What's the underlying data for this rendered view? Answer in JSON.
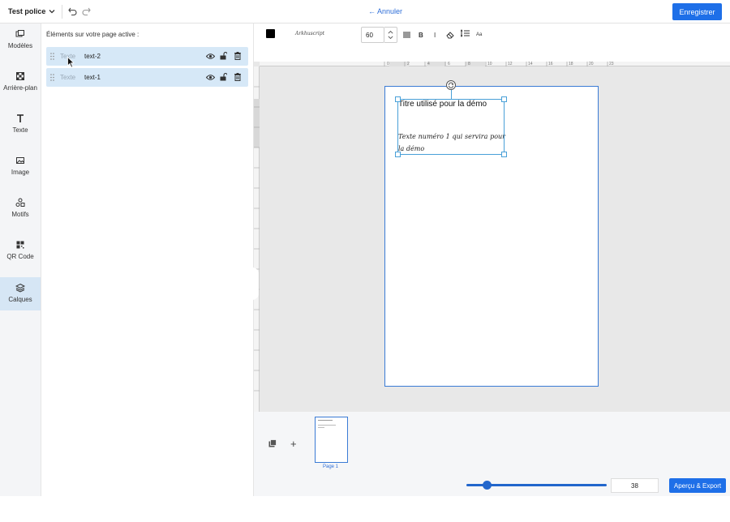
{
  "header": {
    "doc_name": "Test police",
    "cancel_label": "Annuler",
    "save_label": "Enregistrer"
  },
  "sidebar": {
    "items": [
      {
        "label": "Modèles",
        "icon": "templates-icon"
      },
      {
        "label": "Arrière-plan",
        "icon": "background-icon"
      },
      {
        "label": "Texte",
        "icon": "text-icon"
      },
      {
        "label": "Image",
        "icon": "image-icon"
      },
      {
        "label": "Motifs",
        "icon": "shapes-icon"
      },
      {
        "label": "QR Code",
        "icon": "qrcode-icon"
      },
      {
        "label": "Calques",
        "icon": "layers-icon",
        "active": true
      }
    ]
  },
  "layers_panel": {
    "title": "Éléments sur votre page active :",
    "layers": [
      {
        "type": "Texte",
        "name": "text-2"
      },
      {
        "type": "Texte",
        "name": "text-1"
      }
    ]
  },
  "text_toolbar": {
    "color": "#000000",
    "font_name": "Arkhuscript",
    "font_size": "60",
    "bold_label": "B",
    "italic_label": "I",
    "case_label": "Aa"
  },
  "ruler": {
    "labels": [
      "0",
      "2",
      "4",
      "6",
      "8",
      "10",
      "12",
      "14",
      "16",
      "18",
      "20",
      "23"
    ]
  },
  "page_content": {
    "title": "Titre utilisé pour la démo",
    "body": "Texte numéro 1 qui servira pour la démo"
  },
  "pages": {
    "thumb_label": "Page 1"
  },
  "footer": {
    "zoom_fraction": 0.15,
    "zoom_value": "38",
    "export_label": "Aperçu & Export"
  },
  "colors": {
    "accent": "#1e6fe8",
    "selection": "#49a0d8",
    "active_nav": "#d6e6f5"
  }
}
